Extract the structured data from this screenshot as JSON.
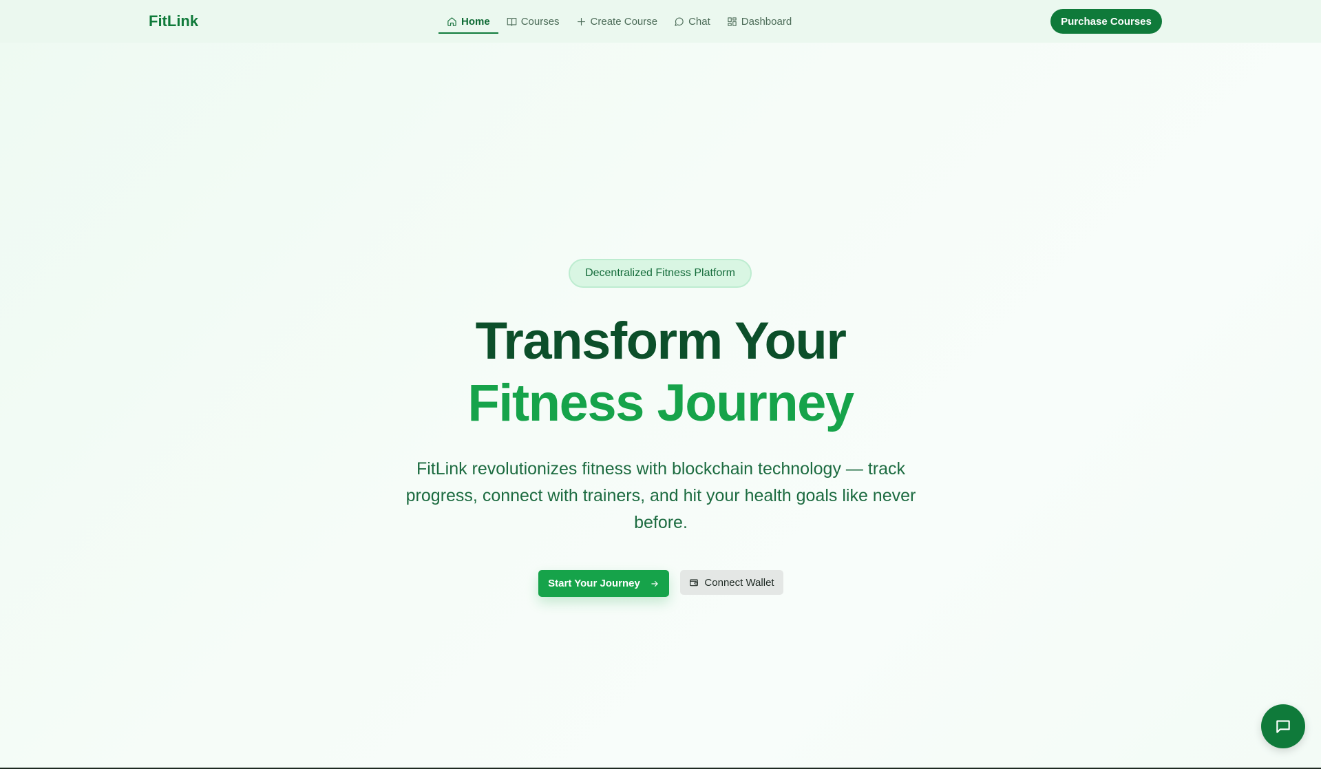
{
  "navbar": {
    "brand": "FitLink",
    "links": [
      {
        "label": "Home",
        "icon": "home-icon",
        "active": true
      },
      {
        "label": "Courses",
        "icon": "book-icon",
        "active": false
      },
      {
        "label": "Create Course",
        "icon": "plus-icon",
        "active": false
      },
      {
        "label": "Chat",
        "icon": "chat-bubble-icon",
        "active": false
      },
      {
        "label": "Dashboard",
        "icon": "dashboard-grid-icon",
        "active": false
      }
    ],
    "purchase_label": "Purchase Courses"
  },
  "hero": {
    "badge": "Decentralized Fitness Platform",
    "headline_line1": "Transform Your",
    "headline_line2": "Fitness Journey",
    "subtitle": "FitLink revolutionizes fitness with blockchain technology — track progress, connect with trainers, and hit your health goals like never before.",
    "primary_cta": "Start Your Journey",
    "secondary_cta": "Connect Wallet"
  },
  "colors": {
    "brand": "#0f7a3a",
    "accent": "#16a34a",
    "headline_dark": "#0c4f2a",
    "background": "#f4fbf6"
  },
  "fab": {
    "icon": "chat-icon"
  }
}
